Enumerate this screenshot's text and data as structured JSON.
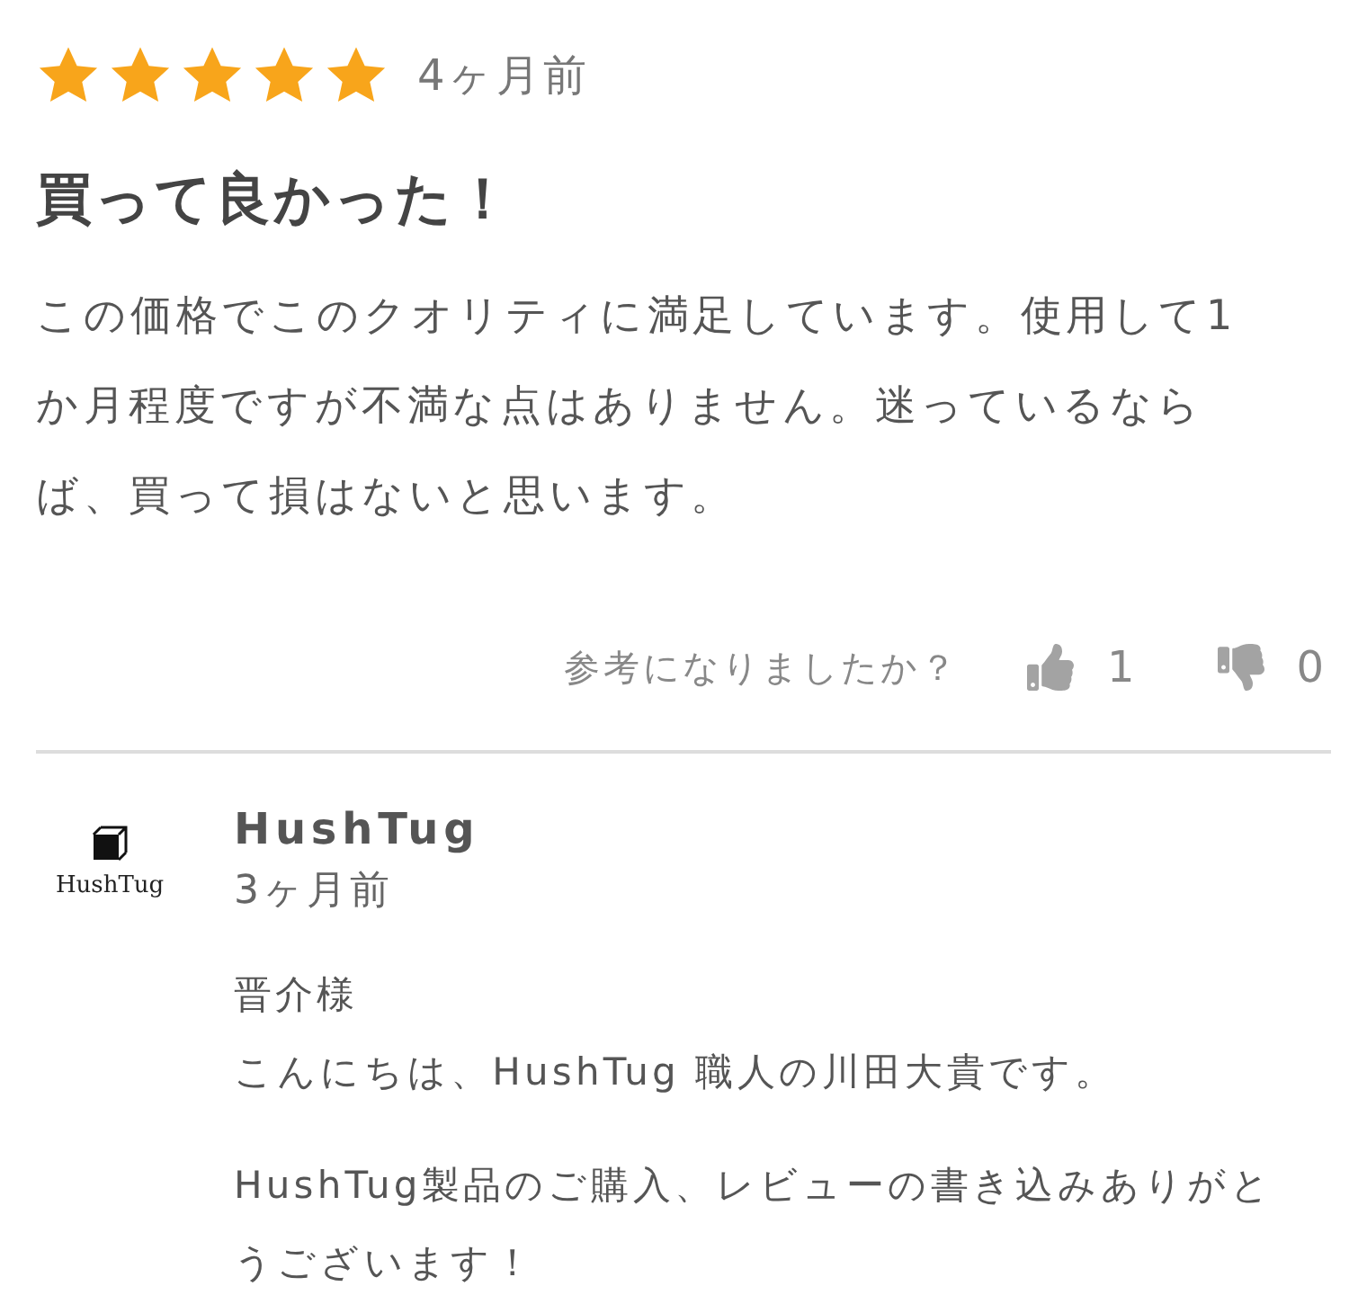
{
  "review": {
    "stars": 5,
    "age": "4ヶ月前",
    "title": "買って良かった！",
    "body": "この価格でこのクオリティに満足しています。使用して1か月程度ですが不満な点はありません。迷っているならば、買って損はないと思います。"
  },
  "helpful": {
    "question": "参考になりましたか？",
    "likes": "1",
    "dislikes": "0"
  },
  "reply": {
    "logo_text": "HushTug",
    "author": "HushTug",
    "age": "3ヶ月前",
    "salutation": "晋介様",
    "greeting": "こんにちは、HushTug 職人の川田大貴です。",
    "paragraphs": [
      "HushTug製品のご購入、レビューの書き込みありがとうございます！"
    ]
  }
}
